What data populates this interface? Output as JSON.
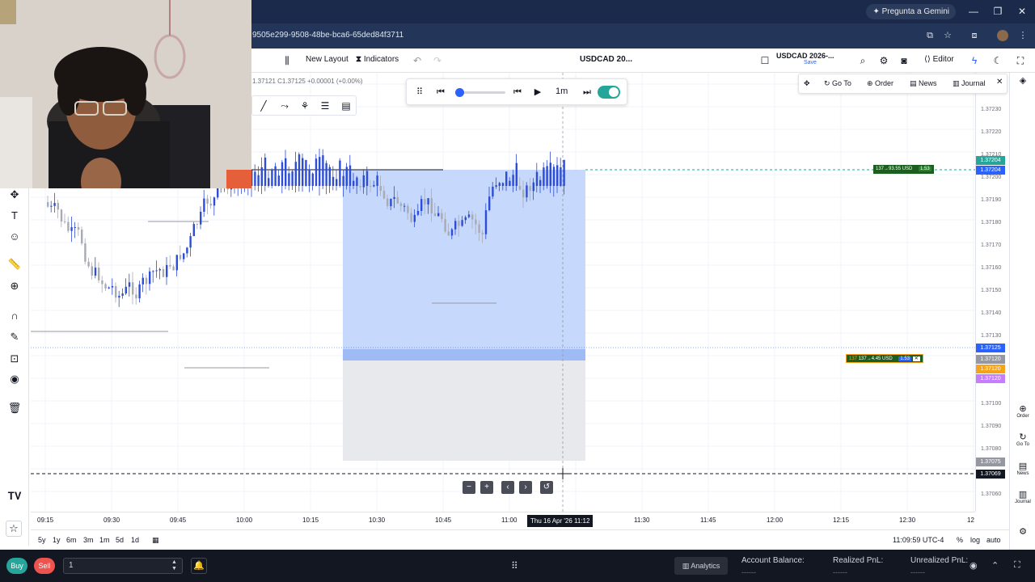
{
  "browser": {
    "gemini_label": "Pregunta a Gemini",
    "url": "9505e299-9508-48be-bca6-65ded84f3711",
    "window_controls": [
      "minimize",
      "restore",
      "close"
    ]
  },
  "toolbar": {
    "layout_label": "New Layout",
    "indicators_label": "Indicators",
    "chart_title": "USDCAD 20...",
    "symbol_label": "USDCAD 2026-...",
    "symbol_sub": "Save",
    "editor_label": "Editor"
  },
  "ohlc_text": "1.37121 C1.37125 +0.00001 (+0.00%)",
  "replay": {
    "interval_label": "1m",
    "progress_fraction": 0.05,
    "toggle_on": true
  },
  "trade_panel": {
    "goto_label": "Go To",
    "order_label": "Order",
    "news_label": "News",
    "journal_label": "Journal"
  },
  "position_labels": {
    "target_text": "137→93.55 USD",
    "target_qty": "1.53",
    "current_text": "137→4.45 USD",
    "current_qty": "1.53",
    "current_prefix": "137"
  },
  "price_axis": {
    "labels": [
      "1.37230",
      "1.37220",
      "1.37210",
      "1.37200",
      "1.37190",
      "1.37180",
      "1.37170",
      "1.37160",
      "1.37150",
      "1.37140",
      "1.37130",
      "1.37110",
      "1.37100",
      "1.37090",
      "1.37080",
      "1.37060"
    ],
    "tags": [
      {
        "text": "1.37204",
        "color": "#26a69a"
      },
      {
        "text": "1.37204",
        "color": "#2962ff"
      },
      {
        "text": "1.37125",
        "color": "#2962ff"
      },
      {
        "text": "1.37120",
        "color": "#9598a1"
      },
      {
        "text": "1.37120",
        "color": "#f7a21b"
      },
      {
        "text": "1.37120",
        "color": "#c77dff"
      },
      {
        "text": "1.37075",
        "color": "#9598a1"
      },
      {
        "text": "1.37069",
        "color": "#131722"
      }
    ]
  },
  "time_axis": {
    "labels": [
      "09:15",
      "09:30",
      "09:45",
      "10:00",
      "10:15",
      "10:30",
      "10:45",
      "11:00",
      "11:30",
      "11:45",
      "12:00",
      "12:15",
      "12:30",
      "12"
    ],
    "cursor_label": "Thu 16 Apr '26   11:12"
  },
  "range_bar": {
    "ranges": [
      "5y",
      "1y",
      "6m",
      "3m",
      "1m",
      "5d",
      "1d"
    ],
    "clock": "11:09:59 UTC-4",
    "percent": "%",
    "log": "log",
    "auto": "auto"
  },
  "right_toolbar": {
    "items": [
      "Order",
      "Go To",
      "News",
      "Journal"
    ]
  },
  "bottom": {
    "buy_label": "Buy",
    "sell_label": "Sell",
    "quantity": "1",
    "analytics_label": "Analytics",
    "account_balance_label": "Account Balance:",
    "account_balance_value": "------",
    "realized_label": "Realized PnL:",
    "realized_value": "------",
    "unrealized_label": "Unrealized PnL:",
    "unrealized_value": "------"
  },
  "icons": [
    "cross-icon",
    "text-icon",
    "smile-icon",
    "ruler-icon",
    "zoom-icon",
    "magnet-icon",
    "pencil-icon",
    "lock-icon",
    "eye-icon",
    "trash-icon",
    "star-icon",
    "camera-icon",
    "settings-icon",
    "moon-icon",
    "fullscreen-icon",
    "layers-icon"
  ]
}
